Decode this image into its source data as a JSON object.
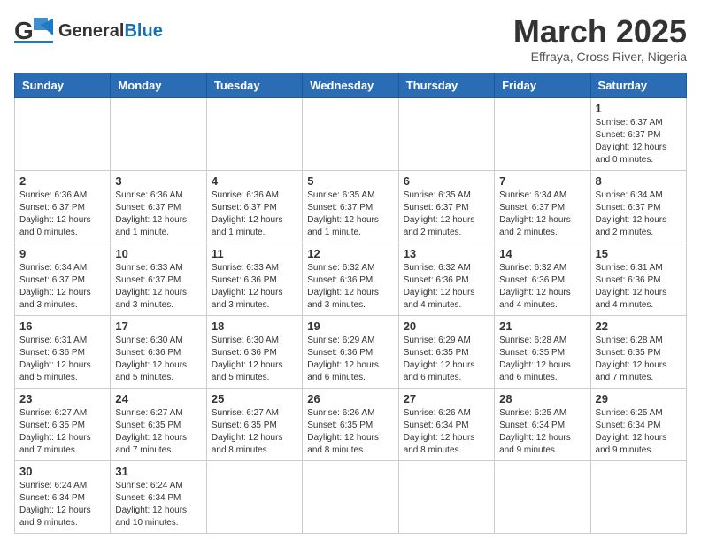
{
  "header": {
    "logo_text_general": "General",
    "logo_text_blue": "Blue",
    "month_title": "March 2025",
    "location": "Effraya, Cross River, Nigeria"
  },
  "weekdays": [
    "Sunday",
    "Monday",
    "Tuesday",
    "Wednesday",
    "Thursday",
    "Friday",
    "Saturday"
  ],
  "weeks": [
    [
      {
        "day": "",
        "info": ""
      },
      {
        "day": "",
        "info": ""
      },
      {
        "day": "",
        "info": ""
      },
      {
        "day": "",
        "info": ""
      },
      {
        "day": "",
        "info": ""
      },
      {
        "day": "",
        "info": ""
      },
      {
        "day": "1",
        "info": "Sunrise: 6:37 AM\nSunset: 6:37 PM\nDaylight: 12 hours\nand 0 minutes."
      }
    ],
    [
      {
        "day": "2",
        "info": "Sunrise: 6:36 AM\nSunset: 6:37 PM\nDaylight: 12 hours\nand 0 minutes."
      },
      {
        "day": "3",
        "info": "Sunrise: 6:36 AM\nSunset: 6:37 PM\nDaylight: 12 hours\nand 1 minute."
      },
      {
        "day": "4",
        "info": "Sunrise: 6:36 AM\nSunset: 6:37 PM\nDaylight: 12 hours\nand 1 minute."
      },
      {
        "day": "5",
        "info": "Sunrise: 6:35 AM\nSunset: 6:37 PM\nDaylight: 12 hours\nand 1 minute."
      },
      {
        "day": "6",
        "info": "Sunrise: 6:35 AM\nSunset: 6:37 PM\nDaylight: 12 hours\nand 2 minutes."
      },
      {
        "day": "7",
        "info": "Sunrise: 6:34 AM\nSunset: 6:37 PM\nDaylight: 12 hours\nand 2 minutes."
      },
      {
        "day": "8",
        "info": "Sunrise: 6:34 AM\nSunset: 6:37 PM\nDaylight: 12 hours\nand 2 minutes."
      }
    ],
    [
      {
        "day": "9",
        "info": "Sunrise: 6:34 AM\nSunset: 6:37 PM\nDaylight: 12 hours\nand 3 minutes."
      },
      {
        "day": "10",
        "info": "Sunrise: 6:33 AM\nSunset: 6:37 PM\nDaylight: 12 hours\nand 3 minutes."
      },
      {
        "day": "11",
        "info": "Sunrise: 6:33 AM\nSunset: 6:36 PM\nDaylight: 12 hours\nand 3 minutes."
      },
      {
        "day": "12",
        "info": "Sunrise: 6:32 AM\nSunset: 6:36 PM\nDaylight: 12 hours\nand 3 minutes."
      },
      {
        "day": "13",
        "info": "Sunrise: 6:32 AM\nSunset: 6:36 PM\nDaylight: 12 hours\nand 4 minutes."
      },
      {
        "day": "14",
        "info": "Sunrise: 6:32 AM\nSunset: 6:36 PM\nDaylight: 12 hours\nand 4 minutes."
      },
      {
        "day": "15",
        "info": "Sunrise: 6:31 AM\nSunset: 6:36 PM\nDaylight: 12 hours\nand 4 minutes."
      }
    ],
    [
      {
        "day": "16",
        "info": "Sunrise: 6:31 AM\nSunset: 6:36 PM\nDaylight: 12 hours\nand 5 minutes."
      },
      {
        "day": "17",
        "info": "Sunrise: 6:30 AM\nSunset: 6:36 PM\nDaylight: 12 hours\nand 5 minutes."
      },
      {
        "day": "18",
        "info": "Sunrise: 6:30 AM\nSunset: 6:36 PM\nDaylight: 12 hours\nand 5 minutes."
      },
      {
        "day": "19",
        "info": "Sunrise: 6:29 AM\nSunset: 6:36 PM\nDaylight: 12 hours\nand 6 minutes."
      },
      {
        "day": "20",
        "info": "Sunrise: 6:29 AM\nSunset: 6:35 PM\nDaylight: 12 hours\nand 6 minutes."
      },
      {
        "day": "21",
        "info": "Sunrise: 6:28 AM\nSunset: 6:35 PM\nDaylight: 12 hours\nand 6 minutes."
      },
      {
        "day": "22",
        "info": "Sunrise: 6:28 AM\nSunset: 6:35 PM\nDaylight: 12 hours\nand 7 minutes."
      }
    ],
    [
      {
        "day": "23",
        "info": "Sunrise: 6:27 AM\nSunset: 6:35 PM\nDaylight: 12 hours\nand 7 minutes."
      },
      {
        "day": "24",
        "info": "Sunrise: 6:27 AM\nSunset: 6:35 PM\nDaylight: 12 hours\nand 7 minutes."
      },
      {
        "day": "25",
        "info": "Sunrise: 6:27 AM\nSunset: 6:35 PM\nDaylight: 12 hours\nand 8 minutes."
      },
      {
        "day": "26",
        "info": "Sunrise: 6:26 AM\nSunset: 6:35 PM\nDaylight: 12 hours\nand 8 minutes."
      },
      {
        "day": "27",
        "info": "Sunrise: 6:26 AM\nSunset: 6:34 PM\nDaylight: 12 hours\nand 8 minutes."
      },
      {
        "day": "28",
        "info": "Sunrise: 6:25 AM\nSunset: 6:34 PM\nDaylight: 12 hours\nand 9 minutes."
      },
      {
        "day": "29",
        "info": "Sunrise: 6:25 AM\nSunset: 6:34 PM\nDaylight: 12 hours\nand 9 minutes."
      }
    ],
    [
      {
        "day": "30",
        "info": "Sunrise: 6:24 AM\nSunset: 6:34 PM\nDaylight: 12 hours\nand 9 minutes."
      },
      {
        "day": "31",
        "info": "Sunrise: 6:24 AM\nSunset: 6:34 PM\nDaylight: 12 hours\nand 10 minutes."
      },
      {
        "day": "",
        "info": ""
      },
      {
        "day": "",
        "info": ""
      },
      {
        "day": "",
        "info": ""
      },
      {
        "day": "",
        "info": ""
      },
      {
        "day": "",
        "info": ""
      }
    ]
  ]
}
